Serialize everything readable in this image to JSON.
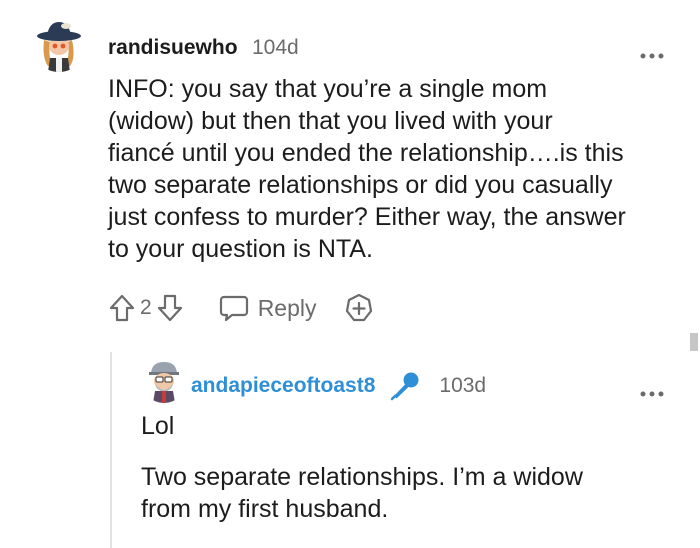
{
  "comment": {
    "username": "randisuewho",
    "age": "104d",
    "more": "•••",
    "text": "INFO: you say that you’re a single mom\n(widow) but then that you lived with your\nfiancé until you ended the relationship….is this\ntwo separate relationships or did you casually\njust confess to murder? Either way, the answer\nto your question is NTA.",
    "votes": "2",
    "reply_label": "Reply",
    "icons": [
      "upvote-icon",
      "downvote-icon",
      "chat-bubble-icon",
      "add-award-icon",
      "more-options-icon"
    ]
  },
  "reply": {
    "username": "andapieceoftoast8",
    "age": "103d",
    "more": "•••",
    "text_1": "Lol",
    "text_2": "Two separate relationships. I’m a widow\nfrom my first husband.",
    "icons": [
      "microphone-icon",
      "more-options-icon"
    ]
  },
  "colors": {
    "text": "#1c1c1c",
    "muted": "#6b6b6b",
    "accent": "#2f8fd6",
    "thread_line": "#e3e3e3"
  }
}
